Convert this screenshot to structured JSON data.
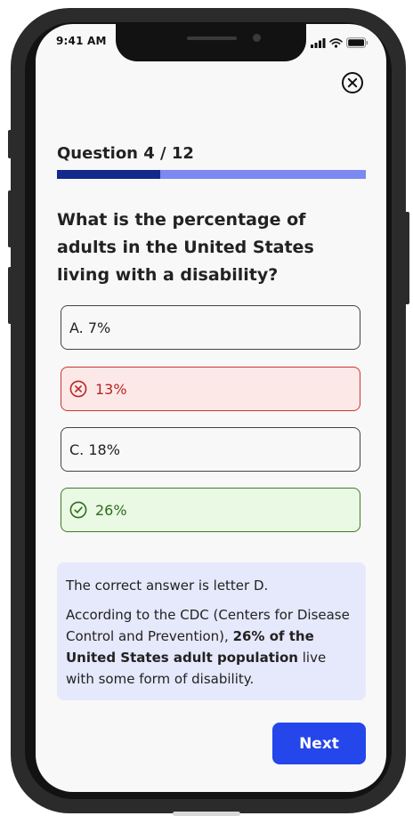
{
  "status_bar": {
    "time": "9:41 AM",
    "icons": [
      "signal-icon",
      "wifi-icon",
      "battery-icon"
    ]
  },
  "quiz": {
    "counter": "Question 4 / 12",
    "progress": 0.333,
    "question": "What is the percentage of adults in the United States living with a disability?",
    "options": [
      {
        "label": "A. 7%",
        "state": "default"
      },
      {
        "label": "13%",
        "state": "incorrect",
        "icon": "x-circle-icon"
      },
      {
        "label": "C. 18%",
        "state": "default"
      },
      {
        "label": "26%",
        "state": "correct",
        "icon": "check-circle-icon"
      }
    ]
  },
  "explanation": {
    "title": "The correct answer is letter D.",
    "body_prefix": "According to the CDC (Centers for Disease Control and Prevention), ",
    "body_bold": "26% of the United States adult population",
    "body_suffix": " live with some form of disability."
  },
  "actions": {
    "next_label": "Next"
  },
  "colors": {
    "accent": "#2446ea",
    "progress_fill": "#14298c",
    "progress_track": "#7b89f0",
    "wrong_bg": "#fde8e8",
    "wrong_border": "#c9342f",
    "correct_bg": "#e9f9e3",
    "correct_border": "#3d7a2a",
    "explanation_bg": "#e6e8fb"
  }
}
